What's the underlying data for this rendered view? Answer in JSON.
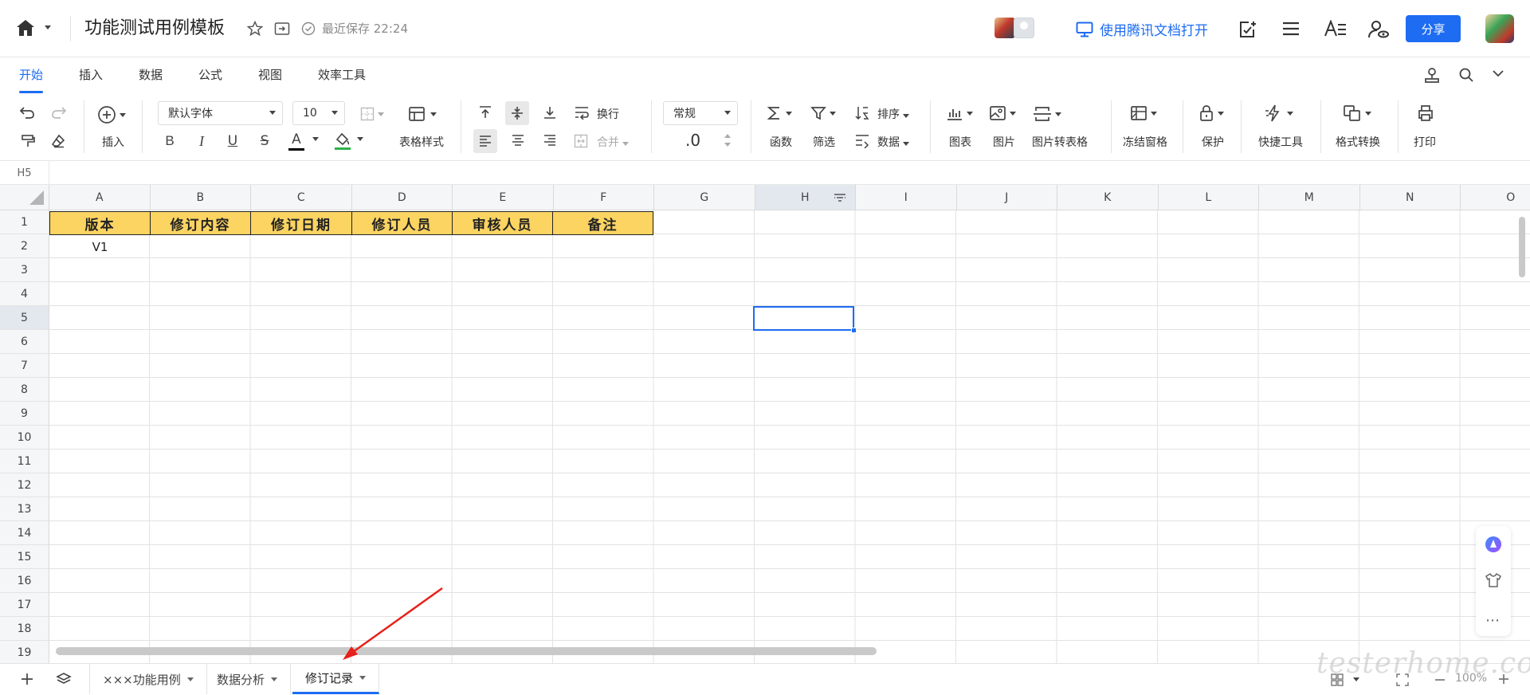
{
  "titlebar": {
    "doc_title": "功能测试用例模板",
    "save_status": "最近保存 22:24",
    "open_app_label": "使用腾讯文档打开",
    "share_label": "分享"
  },
  "ribbon_tabs": [
    "开始",
    "插入",
    "数据",
    "公式",
    "视图",
    "效率工具"
  ],
  "active_tab": "开始",
  "toolbar": {
    "insert_label": "插入",
    "font_family": "默认字体",
    "font_size": "10",
    "table_style_label": "表格样式",
    "wrap_label": "换行",
    "merge_label": "合并",
    "number_format": "常规",
    "decimal_label": ".0",
    "function_label": "函数",
    "filter_label": "筛选",
    "sort_label": "排序",
    "data_label": "数据",
    "chart_label": "图表",
    "image_label": "图片",
    "image_to_table_label": "图片转表格",
    "freeze_label": "冻结窗格",
    "protect_label": "保护",
    "quick_tools_label": "快捷工具",
    "format_convert_label": "格式转换",
    "print_label": "打印",
    "bold": "B",
    "italic": "I",
    "underline": "U",
    "strike": "S",
    "font_color": "A"
  },
  "colors": {
    "accent": "#1d6cf2",
    "header_fill": "#fcd462",
    "font_color_bar": "#000000",
    "fill_color_bar": "#2db34a"
  },
  "formula_bar": {
    "cell_ref": "H5",
    "value": ""
  },
  "grid": {
    "columns": [
      "A",
      "B",
      "C",
      "D",
      "E",
      "F",
      "G",
      "H",
      "I",
      "J",
      "K",
      "L",
      "M",
      "N",
      "O"
    ],
    "rows": [
      "1",
      "2",
      "3",
      "4",
      "5",
      "6",
      "7",
      "8",
      "9",
      "10",
      "11",
      "12",
      "13",
      "14",
      "15",
      "16",
      "17",
      "18",
      "19"
    ],
    "header_row": [
      "版本",
      "修订内容",
      "修订日期",
      "修订人员",
      "审核人员",
      "备注"
    ],
    "row2": {
      "A": "V1"
    },
    "selected_cell": "H5"
  },
  "sheets": [
    {
      "label": "×××功能用例",
      "active": false
    },
    {
      "label": "数据分析",
      "active": false
    },
    {
      "label": "修订记录",
      "active": true
    }
  ],
  "zoom": "100%",
  "watermark": "testerhome.com",
  "icons": [
    "home-icon",
    "star-icon",
    "move-to-folder-icon",
    "saved-check-icon",
    "monitor-icon",
    "edit-doc-icon",
    "menu-icon",
    "font-settings-icon",
    "user-settings-icon",
    "search-icon",
    "collapse-icon",
    "undo-icon",
    "redo-icon",
    "format-painter-icon",
    "eraser-icon",
    "add-circle-icon",
    "sigma-icon",
    "funnel-icon",
    "sort-icon",
    "chart-icon",
    "image-icon",
    "freeze-icon",
    "lock-icon",
    "flash-icon",
    "convert-icon",
    "printer-icon",
    "layers-icon",
    "plus-icon",
    "zoom-out-icon",
    "zoom-in-icon",
    "fullscreen-icon",
    "grid-view-icon",
    "ai-assistant-icon",
    "skin-icon",
    "more-icon"
  ]
}
